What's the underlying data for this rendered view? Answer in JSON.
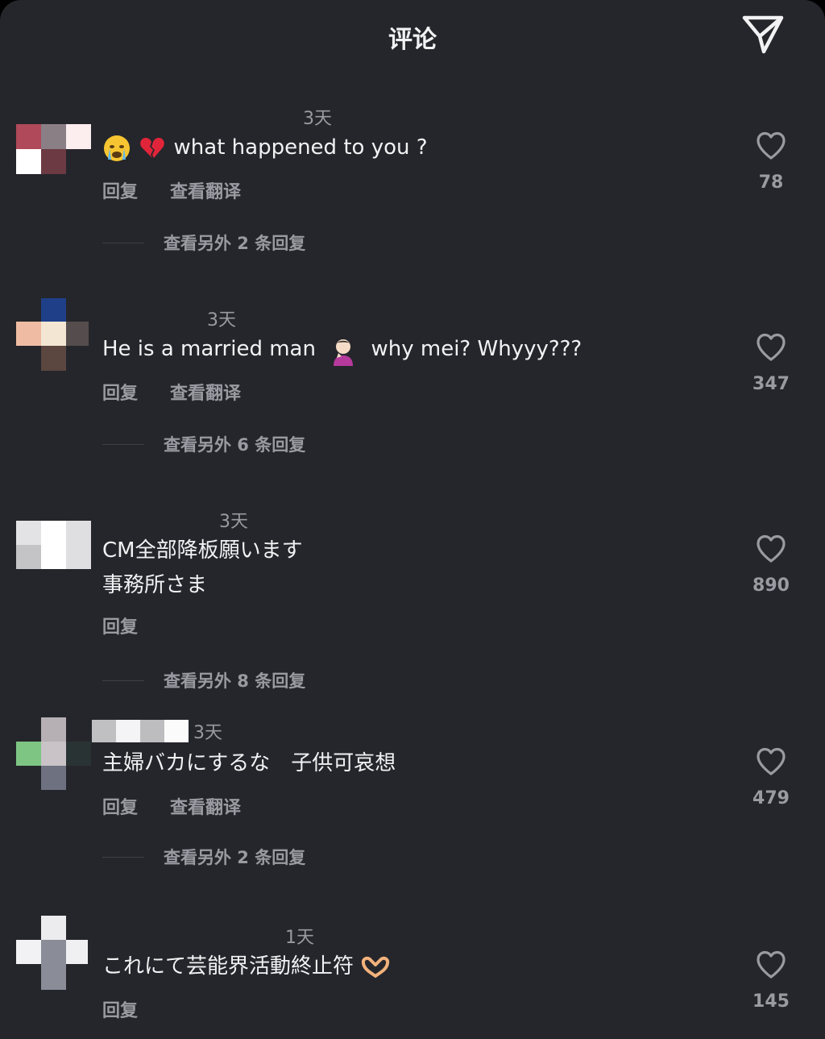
{
  "header": {
    "title": "评论"
  },
  "comments": [
    {
      "time": "3天",
      "text": "what happened to you ?",
      "emojis": [
        "crying-face",
        "broken-heart"
      ],
      "actions": {
        "reply": "回复",
        "translate": "查看翻译"
      },
      "more_replies": "查看另外 2 条回复",
      "likes": "78"
    },
    {
      "time": "3天",
      "text_before": "He is a married man",
      "emoji": "woman-shrugging",
      "text_after": "why mei? Whyyy???",
      "actions": {
        "reply": "回复",
        "translate": "查看翻译"
      },
      "more_replies": "查看另外 6 条回复",
      "likes": "347"
    },
    {
      "time": "3天",
      "text_line1": "CM全部降板願います",
      "text_line2": "事務所さま",
      "actions": {
        "reply": "回复"
      },
      "more_replies": "查看另外 8 条回复",
      "likes": "890"
    },
    {
      "time": "3天",
      "text": "主婦バカにするな　子供可哀想",
      "actions": {
        "reply": "回复",
        "translate": "查看翻译"
      },
      "more_replies": "查看另外 2 条回复",
      "likes": "479"
    },
    {
      "time": "1天",
      "text": "これにて芸能界活動終止符",
      "emoji": "heart-hands",
      "actions": {
        "reply": "回复"
      },
      "likes": "145"
    }
  ],
  "colors": {
    "background": "#25262b",
    "primary_text": "#f2f2f4",
    "secondary_text": "#9a9ba2"
  }
}
